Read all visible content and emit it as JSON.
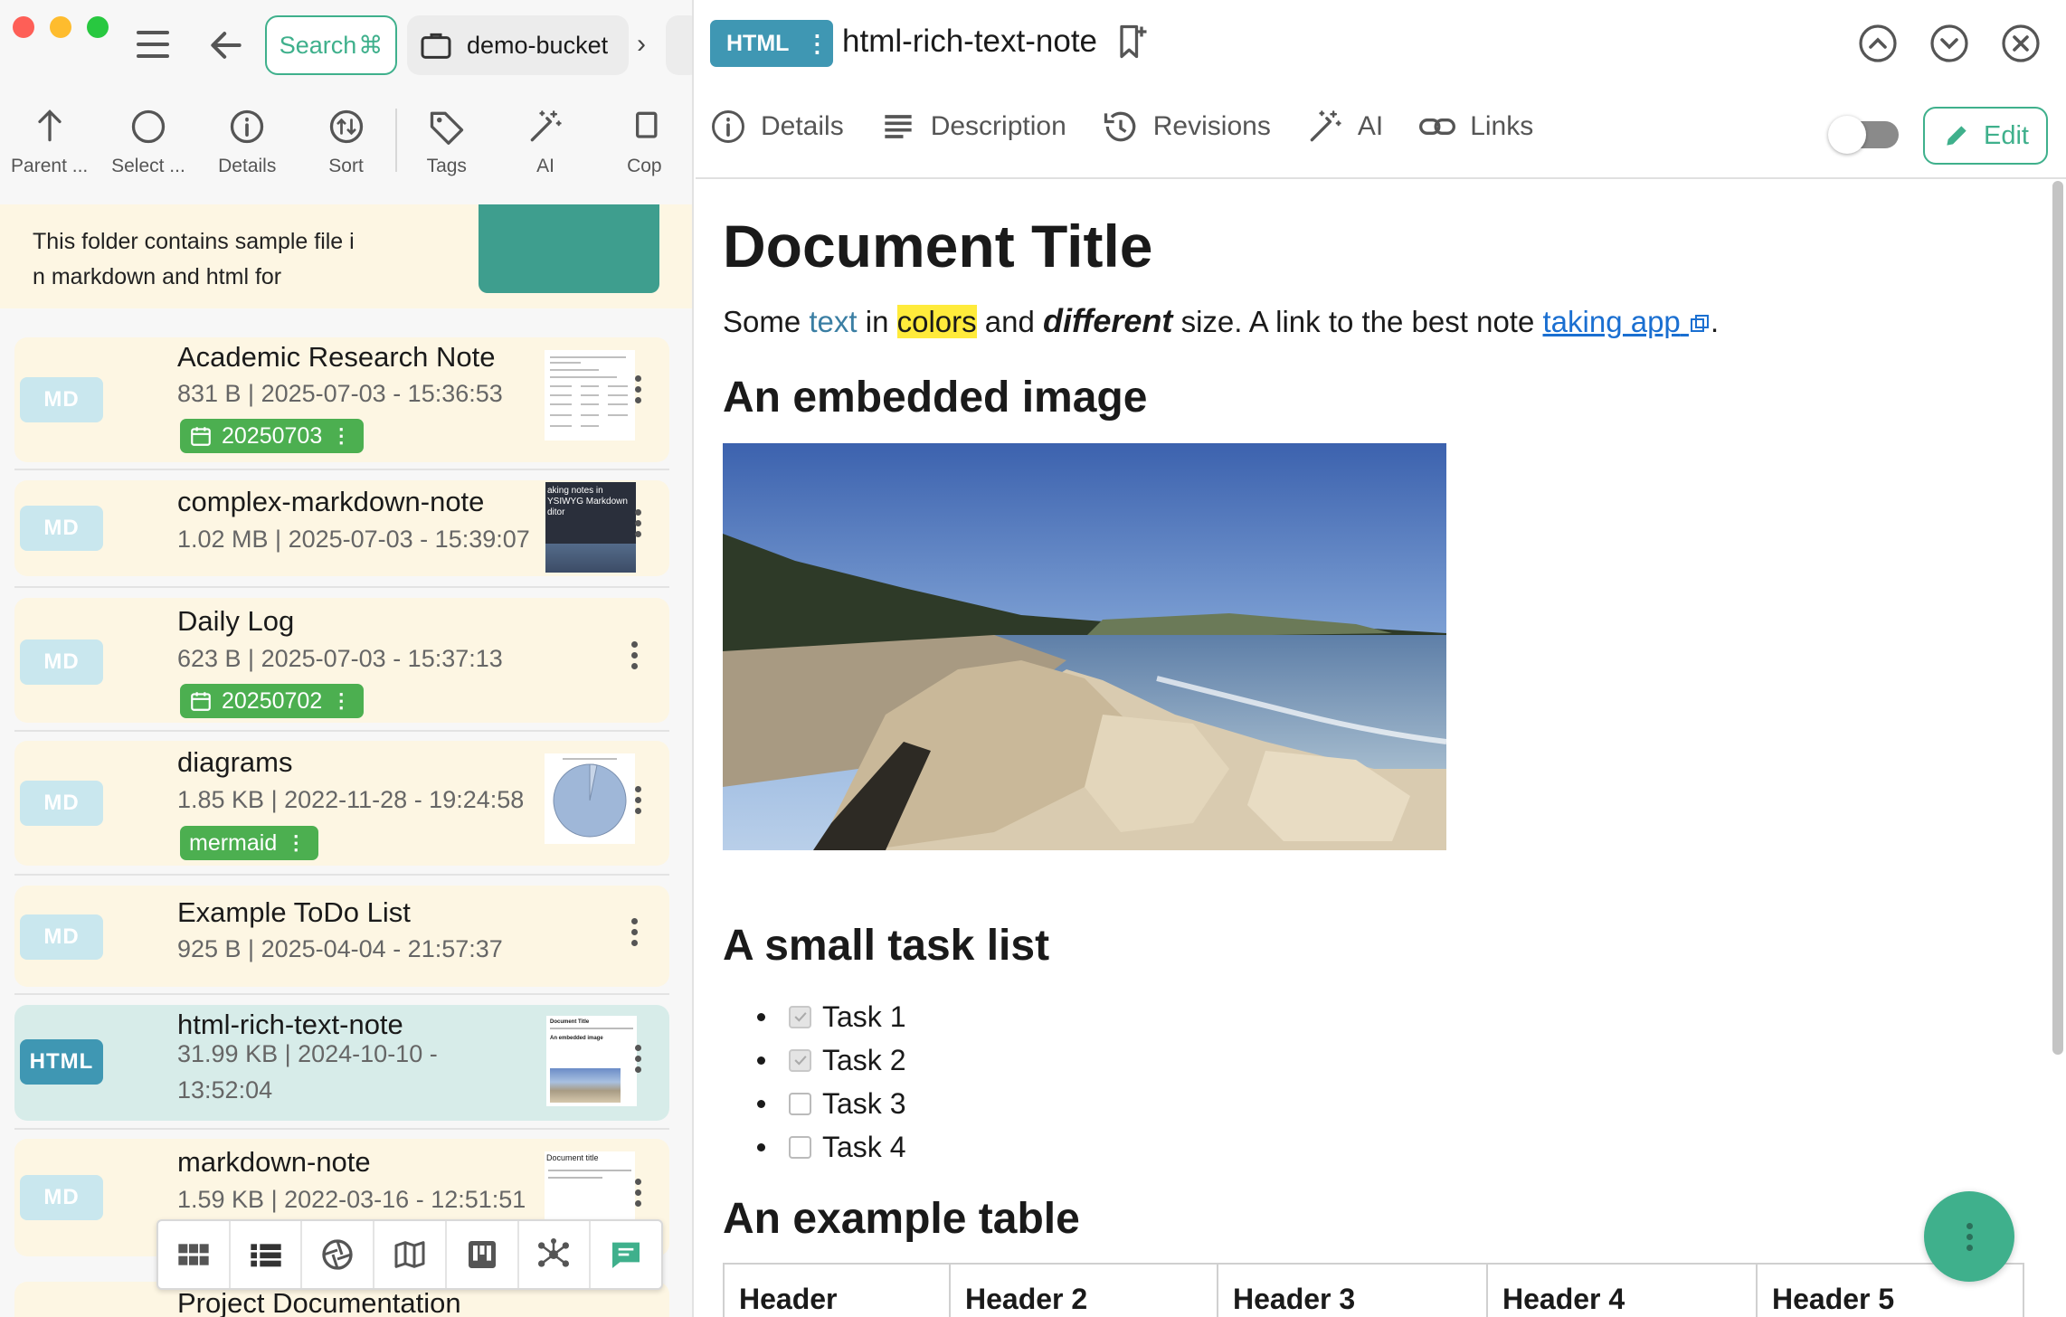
{
  "window": {
    "traffic_colors": [
      "#fe5f57",
      "#febc2e",
      "#28c840"
    ]
  },
  "breadcrumb": {
    "search_label": "Search",
    "search_shortcut": "⌘",
    "bucket_label": "demo-bucket",
    "separator": "›"
  },
  "toolbar": {
    "items": [
      {
        "label": "Parent ...",
        "icon": "arrow-up-icon"
      },
      {
        "label": "Select ...",
        "icon": "circle-icon"
      },
      {
        "label": "Details",
        "icon": "info-icon"
      },
      {
        "label": "Sort",
        "icon": "sort-icon"
      },
      {
        "label": "Tags",
        "icon": "tag-icon"
      },
      {
        "label": "AI",
        "icon": "magic-wand-icon"
      },
      {
        "label": "Cop",
        "icon": "copy-icon"
      }
    ]
  },
  "folder": {
    "description": "This folder contains sample file in markdown and html for"
  },
  "files": [
    {
      "type": "MD",
      "name": "Academic Research Note",
      "meta": "831 B | 2025-07-03 - 15:36:53",
      "tag": "20250703",
      "tag_icon": "calendar-icon"
    },
    {
      "type": "MD",
      "name": "complex-markdown-note",
      "meta": "1.02 MB | 2025-07-03 - 15:39:07",
      "thumb_text": "aking notes in YSIWYG Markdown ditor"
    },
    {
      "type": "MD",
      "name": "Daily Log",
      "meta": "623 B | 2025-07-03 - 15:37:13",
      "tag": "20250702",
      "tag_icon": "calendar-icon"
    },
    {
      "type": "MD",
      "name": "diagrams",
      "meta": "1.85 KB | 2022-11-28 - 19:24:58",
      "tag": "mermaid"
    },
    {
      "type": "MD",
      "name": "Example ToDo List",
      "meta": "925 B | 2025-04-04 - 21:57:37"
    },
    {
      "type": "HTML",
      "name": "html-rich-text-note",
      "meta": "31.99 KB | 2024-10-10 - 13:52:04",
      "thumb_title": "Document Title",
      "thumb_subtitle": "An embedded image"
    },
    {
      "type": "MD",
      "name": "markdown-note",
      "meta": "1.59 KB | 2022-03-16 - 12:51:51",
      "thumb_text": "Document title"
    },
    {
      "type": "MD",
      "name": "Project Documentation"
    }
  ],
  "view_bar": [
    "grid-view-icon",
    "list-view-icon",
    "gallery-icon",
    "map-icon",
    "kanban-icon",
    "graph-icon",
    "chat-icon"
  ],
  "header": {
    "type_badge": "HTML",
    "title": "html-rich-text-note",
    "tabs": [
      "Details",
      "Description",
      "Revisions",
      "AI",
      "Links"
    ],
    "edit_label": "Edit",
    "accent": "#3fb08c",
    "html_badge_color": "#3f97b3"
  },
  "document": {
    "title": "Document Title",
    "para": {
      "p1": "Some ",
      "p2": "text",
      "p3": " in ",
      "p4": "colors",
      "p5": " and ",
      "p6": "different",
      "p7": " size. A link to the best note ",
      "p8": "taking app",
      "p9": "."
    },
    "h_image": "An embedded image",
    "h_tasks": "A small task list",
    "tasks": [
      {
        "label": "Task 1",
        "done": true
      },
      {
        "label": "Task 2",
        "done": true
      },
      {
        "label": "Task 3",
        "done": false
      },
      {
        "label": "Task 4",
        "done": false
      }
    ],
    "h_table": "An example table",
    "table_headers": [
      "Header",
      "Header 2",
      "Header 3",
      "Header 4",
      "Header 5"
    ]
  }
}
